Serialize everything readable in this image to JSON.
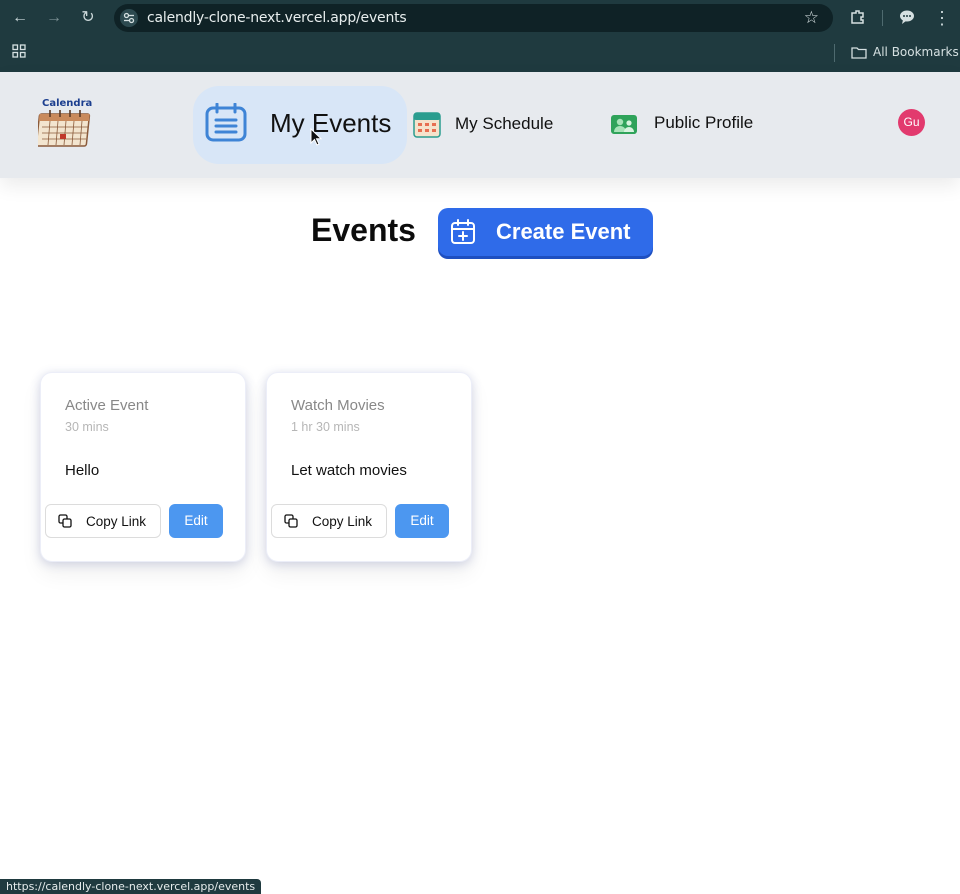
{
  "browser": {
    "url": "calendly-clone-next.vercel.app/events",
    "bookmarks_label": "All Bookmarks",
    "status_url": "https://calendly-clone-next.vercel.app/events"
  },
  "header": {
    "logo_text": "Calendra",
    "nav": {
      "my_events": "My Events",
      "my_schedule": "My Schedule",
      "public_profile": "Public Profile"
    },
    "avatar_initials": "Gu"
  },
  "main": {
    "title": "Events",
    "create_button": "Create Event",
    "events": [
      {
        "title": "Active Event",
        "duration": "30 mins",
        "description": "Hello",
        "copy_label": "Copy Link",
        "edit_label": "Edit"
      },
      {
        "title": "Watch Movies",
        "duration": "1 hr 30 mins",
        "description": "Let watch movies",
        "copy_label": "Copy Link",
        "edit_label": "Edit"
      }
    ]
  },
  "colors": {
    "chrome": "#1f3a3f",
    "header_bg": "#e7eaee",
    "active_nav": "#d8e6f7",
    "primary": "#2f6be9",
    "edit": "#4c97f0",
    "avatar": "#e23a6e"
  }
}
